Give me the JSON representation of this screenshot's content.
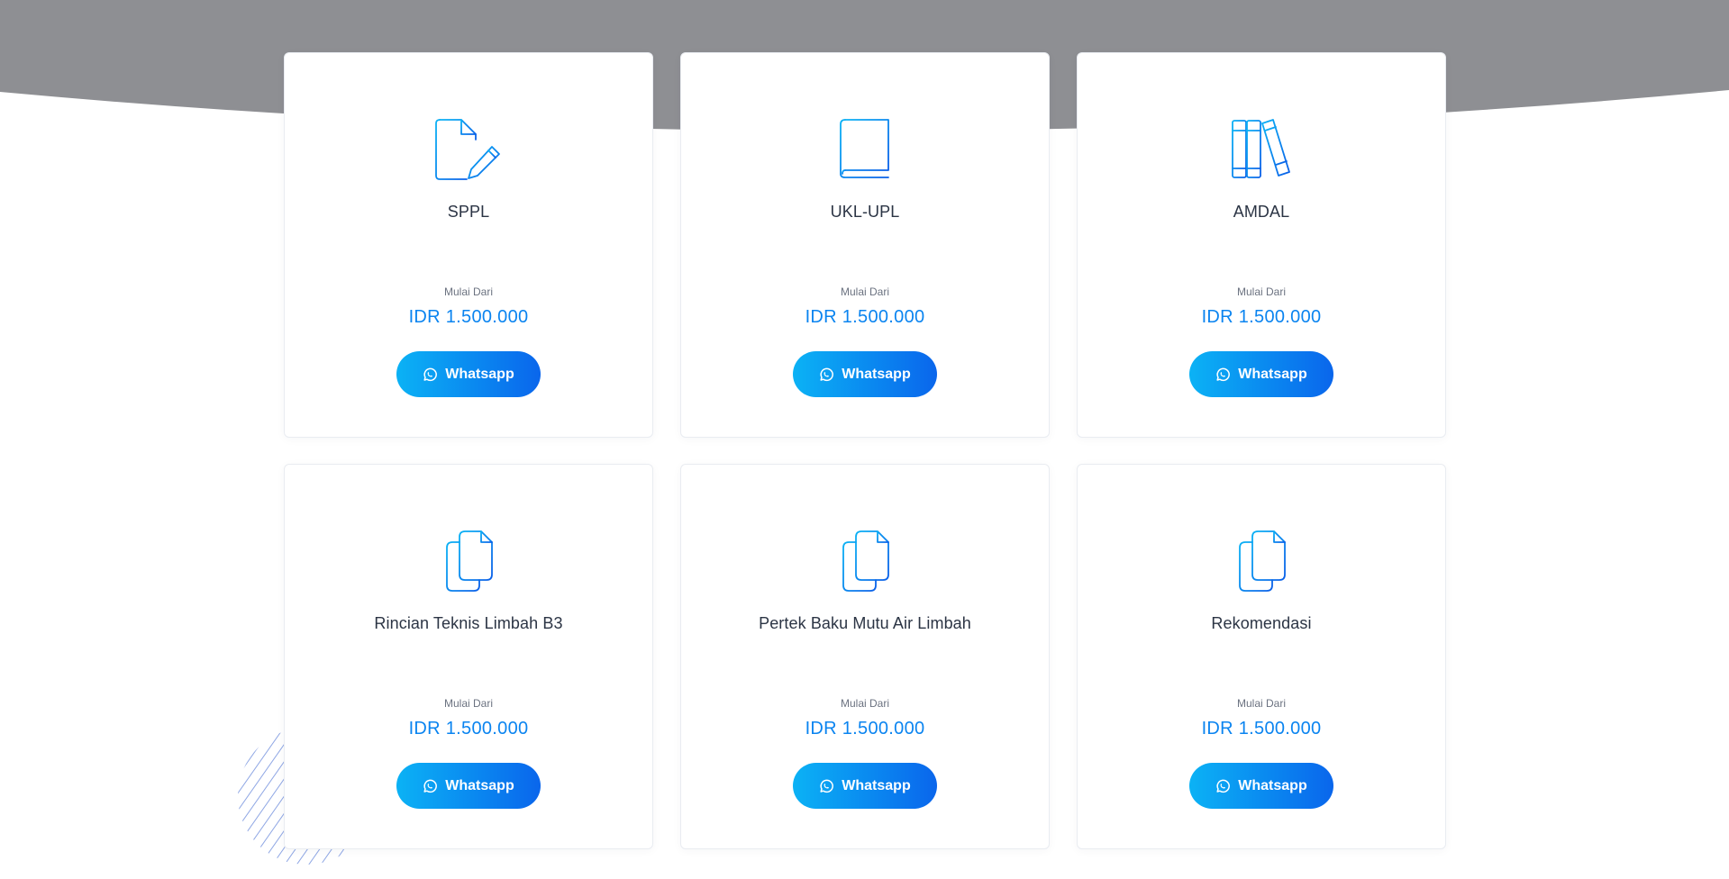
{
  "theme": {
    "accent_start": "#0bb2f5",
    "accent_end": "#0a66ec",
    "price_color": "#0a84f0",
    "band_color": "#8e8f93"
  },
  "services": [
    {
      "title": "SPPL",
      "icon": "document-edit-icon",
      "from_label": "Mulai Dari",
      "price": "IDR 1.500.000",
      "button_label": "Whatsapp"
    },
    {
      "title": "UKL-UPL",
      "icon": "book-icon",
      "from_label": "Mulai Dari",
      "price": "IDR 1.500.000",
      "button_label": "Whatsapp"
    },
    {
      "title": "AMDAL",
      "icon": "books-icon",
      "from_label": "Mulai Dari",
      "price": "IDR 1.500.000",
      "button_label": "Whatsapp"
    },
    {
      "title": "Rincian Teknis Limbah B3",
      "icon": "files-icon",
      "from_label": "Mulai Dari",
      "price": "IDR 1.500.000",
      "button_label": "Whatsapp"
    },
    {
      "title": "Pertek Baku Mutu Air Limbah",
      "icon": "files-icon",
      "from_label": "Mulai Dari",
      "price": "IDR 1.500.000",
      "button_label": "Whatsapp"
    },
    {
      "title": "Rekomendasi",
      "icon": "files-icon",
      "from_label": "Mulai Dari",
      "price": "IDR 1.500.000",
      "button_label": "Whatsapp"
    }
  ]
}
